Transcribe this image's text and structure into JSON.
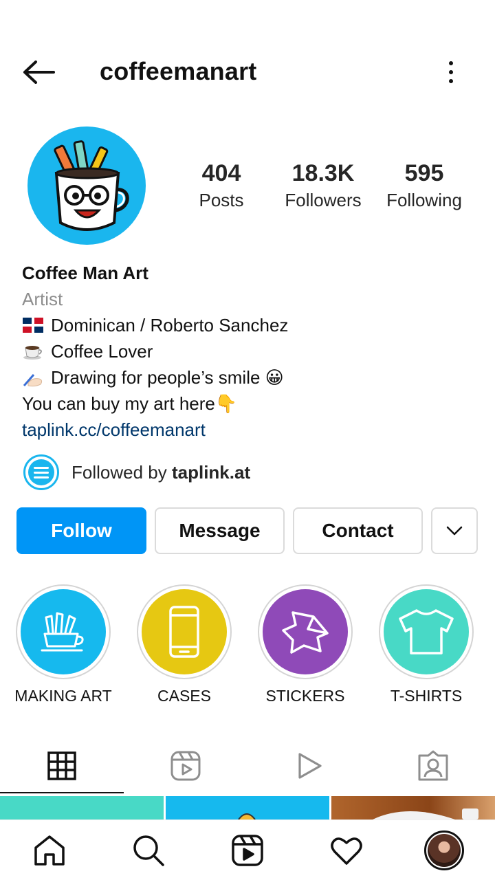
{
  "header": {
    "username": "coffeemanart",
    "back_icon": "arrow-left-icon",
    "more_icon": "more-vertical-icon"
  },
  "profile": {
    "avatar_icon": "coffee-mug-mascot-icon",
    "stats": [
      {
        "value": "404",
        "label": "Posts"
      },
      {
        "value": "18.3K",
        "label": "Followers"
      },
      {
        "value": "595",
        "label": "Following"
      }
    ]
  },
  "bio": {
    "name": "Coffee Man Art",
    "category": "Artist",
    "lines": [
      {
        "emoji": "dominican-flag-icon",
        "text": "Dominican / Roberto Sanchez"
      },
      {
        "emoji": "coffee-cup-icon",
        "text": "Coffee Lover"
      },
      {
        "emoji": "writing-hand-icon",
        "text": "Drawing for people’s smile 😀"
      }
    ],
    "buy_line": "You can buy my art here👇",
    "link": "taplink.cc/coffeemanart"
  },
  "followed_by": {
    "prefix": "Followed by ",
    "account": "taplink.at"
  },
  "actions": {
    "follow": "Follow",
    "message": "Message",
    "contact": "Contact",
    "more_icon": "chevron-down-icon"
  },
  "highlights": [
    {
      "label": "MAKING ART",
      "color": "#16b9ee",
      "icon": "pencil-cup-icon"
    },
    {
      "label": "CASES",
      "color": "#e6c812",
      "icon": "phone-icon"
    },
    {
      "label": "STICKERS",
      "color": "#8f4ab8",
      "icon": "sticker-icon"
    },
    {
      "label": "T-SHIRTS",
      "color": "#48d9c6",
      "icon": "tshirt-icon"
    }
  ],
  "tabs": [
    {
      "icon": "grid-icon",
      "active": true
    },
    {
      "icon": "reels-icon",
      "active": false
    },
    {
      "icon": "video-play-icon",
      "active": false
    },
    {
      "icon": "tagged-person-icon",
      "active": false
    }
  ],
  "bottom_nav": [
    {
      "icon": "home-icon"
    },
    {
      "icon": "search-icon"
    },
    {
      "icon": "reels-icon"
    },
    {
      "icon": "heart-icon"
    },
    {
      "icon": "profile-avatar"
    }
  ],
  "colors": {
    "accent": "#0095f6",
    "link": "#00376b",
    "muted": "#8e8e8e",
    "border": "#dbdbdb"
  }
}
